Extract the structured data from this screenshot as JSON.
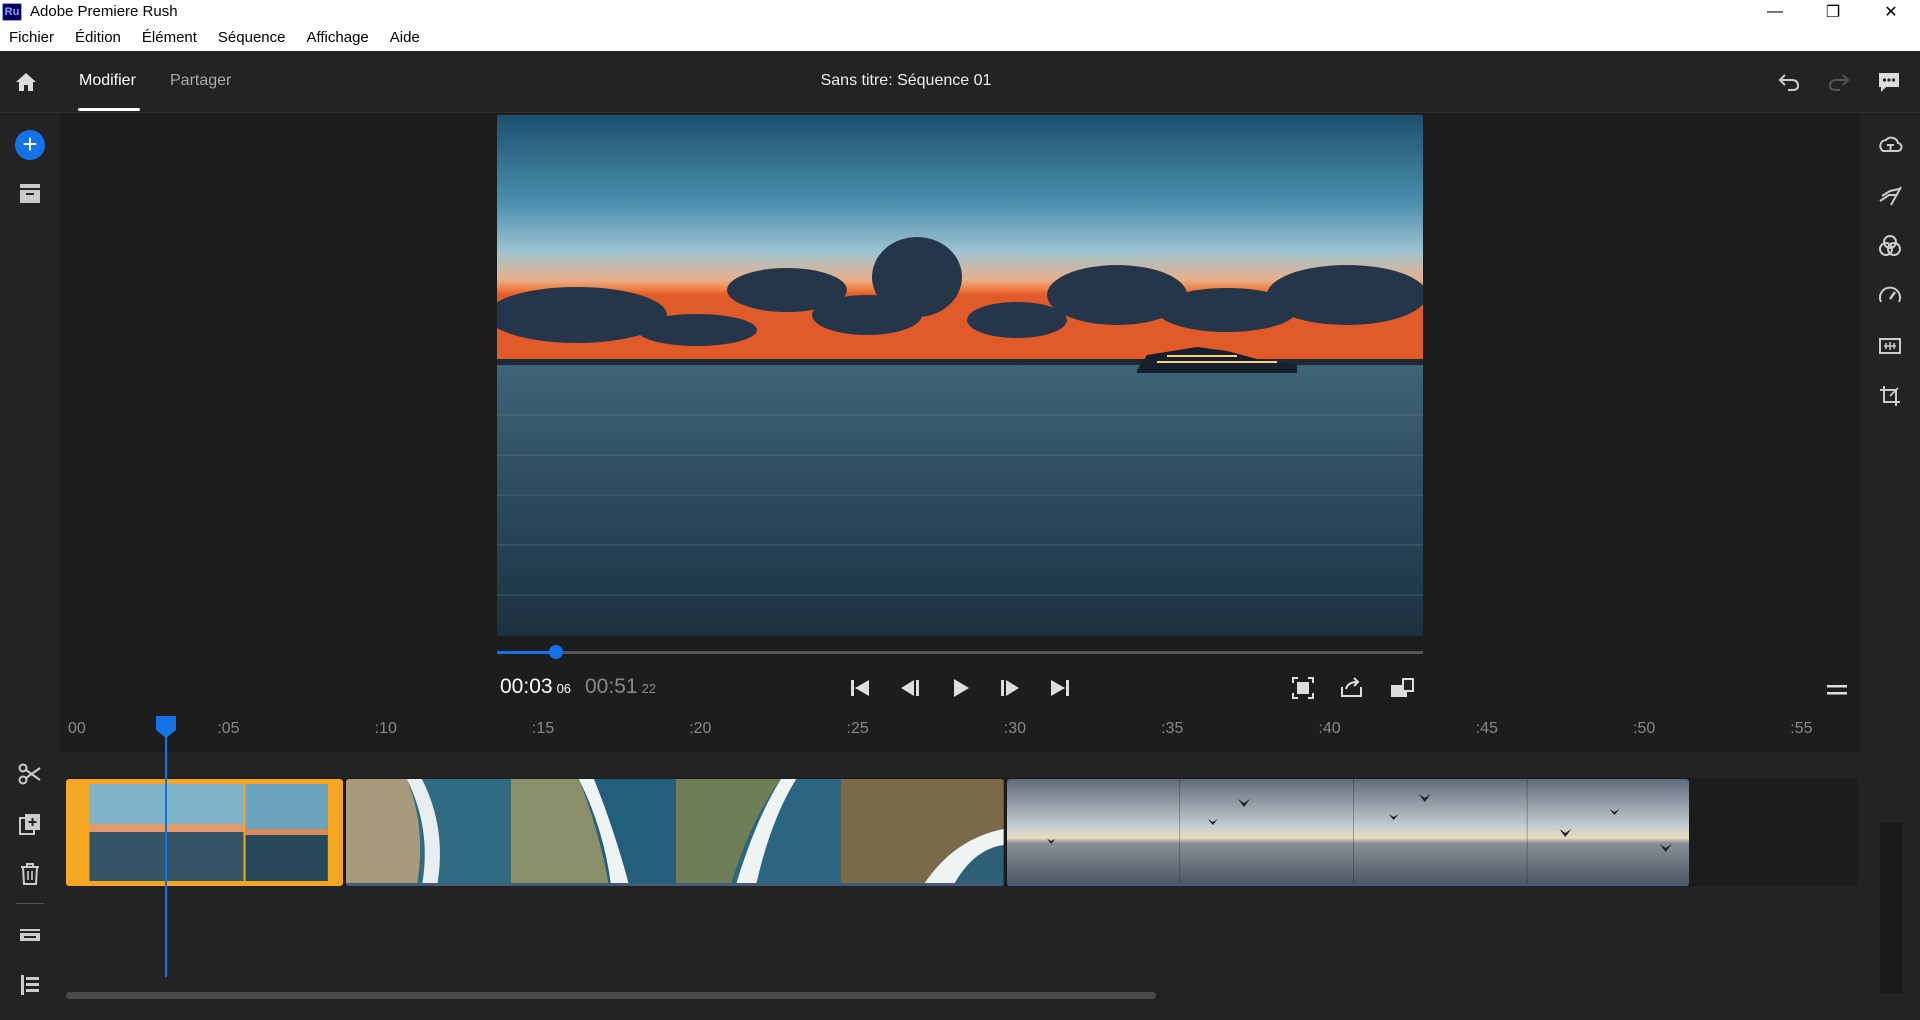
{
  "window": {
    "app_logo": "Ru",
    "title": "Adobe Premiere Rush",
    "controls": {
      "minimize": "—",
      "restore": "❐",
      "close": "✕"
    }
  },
  "menu": {
    "items": [
      "Fichier",
      "Édition",
      "Élément",
      "Séquence",
      "Affichage",
      "Aide"
    ]
  },
  "header": {
    "tabs": [
      {
        "label": "Modifier",
        "active": true
      },
      {
        "label": "Partager",
        "active": false
      }
    ],
    "sequence_title": "Sans titre: Séquence  01"
  },
  "left_toolbar": {
    "items": [
      "add-media",
      "project-assets",
      "split",
      "duplicate",
      "delete",
      "track-controls",
      "track-list"
    ]
  },
  "right_toolbar": {
    "items": [
      "titles",
      "transitions",
      "color",
      "speed",
      "audio",
      "transform"
    ]
  },
  "player": {
    "current_time": "00:03",
    "current_frames": "06",
    "total_time": "00:51",
    "total_frames": "22",
    "progress": 0.064
  },
  "timeline": {
    "ticks": [
      "00",
      ":05",
      ":10",
      ":15",
      ":20",
      ":25",
      ":30",
      ":35",
      ":40",
      ":45",
      ":50",
      ":55"
    ],
    "playhead_seconds": 3.06,
    "clips": [
      {
        "name": "sunset-ship",
        "start_seconds": 0,
        "end_seconds": 8.9,
        "selected": true
      },
      {
        "name": "aerial-coast",
        "start_seconds": 8.9,
        "end_seconds": 29.9,
        "selected": false
      },
      {
        "name": "birds-sea",
        "start_seconds": 29.9,
        "end_seconds": 51.7,
        "selected": false
      }
    ]
  },
  "colors": {
    "accent": "#1473e6",
    "selection": "#f5a623",
    "panel": "#232323",
    "background": "#1d1d1d"
  }
}
